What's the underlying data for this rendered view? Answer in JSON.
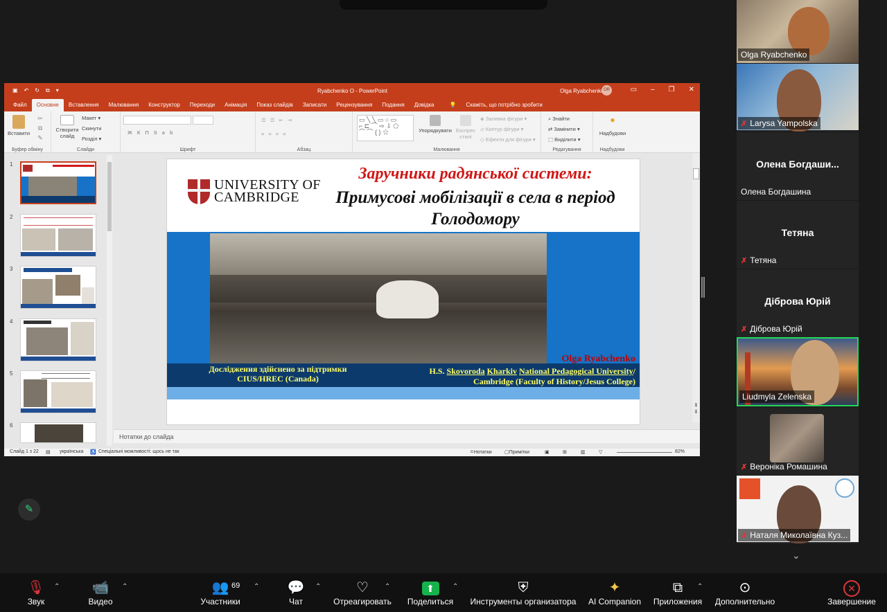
{
  "app": {
    "title": "Ryabchenko O  -  PowerPoint",
    "user": "Olga Ryabchenko",
    "user_initials": "OR"
  },
  "ribbon_tabs": [
    "Файл",
    "Основне",
    "Вставлення",
    "Малювання",
    "Конструктор",
    "Переходи",
    "Анімація",
    "Показ слайдів",
    "Записати",
    "Рецензування",
    "Подання",
    "Довідка"
  ],
  "tell_me": "Скажіть, що потрібно зробити",
  "ribbon": {
    "paste": "Вставити",
    "clipboard": "Буфер обміну",
    "new_slide": "Створити слайд",
    "layout": "Макет",
    "reset": "Скинути",
    "section": "Розділ",
    "slides": "Слайди",
    "font": "Шрифт",
    "paragraph": "Абзац",
    "arrange": "Упорядкувати",
    "quick_styles": "Експрес стилі",
    "shape_fill": "Заливка фігури",
    "shape_outline": "Контур фігури",
    "shape_effects": "Ефекти для фігури",
    "drawing": "Малювання",
    "find": "Знайти",
    "replace": "Замінити",
    "select": "Виділити",
    "editing": "Редагування",
    "addins": "Надбудови",
    "addins_group": "Надбудови"
  },
  "thumbs": [
    "1",
    "2",
    "3",
    "4",
    "5",
    "6"
  ],
  "slide": {
    "university_line1": "UNIVERSITY OF",
    "university_line2": "CAMBRIDGE",
    "title_red": "Заручники радянської системи:",
    "title_black": "Примусові мобілізації в села в період Голодомору",
    "author": "Olga Ryabchenko",
    "support_line1": "Дослідження здійснено за підтримки",
    "support_line2": "CIUS/HREC (Canada)",
    "aff_hs": "H.S. ",
    "aff_skov": "Skovoroda",
    "aff_kharkiv": "Kharkiv",
    "aff_npu": "National Pedagogical University",
    "aff_slash": "/",
    "aff_line2": "Cambridge (Faculty of History/Jesus College)"
  },
  "notes_placeholder": "Нотатки до слайда",
  "status": {
    "slide_count": "Слайд 1 з 22",
    "language": "українська",
    "accessibility": "Спеціальні можливості: щось не так",
    "notes": "Нотатки",
    "comments": "Примітки",
    "zoom": "82%"
  },
  "participants": [
    {
      "name": "Olga Ryabchenko",
      "muted": false
    },
    {
      "name": "Larysa Yampolska",
      "muted": true
    },
    {
      "name": "Олена Богдашина",
      "display": "Олена  Богдаши...",
      "muted": false
    },
    {
      "name": "Тетяна",
      "display": "Тетяна",
      "muted": true
    },
    {
      "name": "Діброва Юрій",
      "display": "Діброва Юрій",
      "muted": true
    },
    {
      "name": "Liudmyla Zelenska",
      "muted": false
    },
    {
      "name": "Вероніка Ромашина",
      "muted": true
    },
    {
      "name": "Наталя Миколаївна Куз...",
      "muted": true
    }
  ],
  "toolbar": {
    "audio": "Звук",
    "video": "Видео",
    "participants": "Участники",
    "participants_count": "69",
    "chat": "Чат",
    "react": "Отреагировать",
    "share": "Поделиться",
    "host_tools": "Инструменты организатора",
    "ai": "AI Companion",
    "apps": "Приложения",
    "more": "Дополнительно",
    "end": "Завершение"
  },
  "colors": {
    "ppt_accent": "#c43e1c",
    "slide_blue": "#1673c7",
    "slide_dark_blue": "#0d3a6d",
    "share_green": "#16b24b",
    "end_red": "#e0363b"
  }
}
